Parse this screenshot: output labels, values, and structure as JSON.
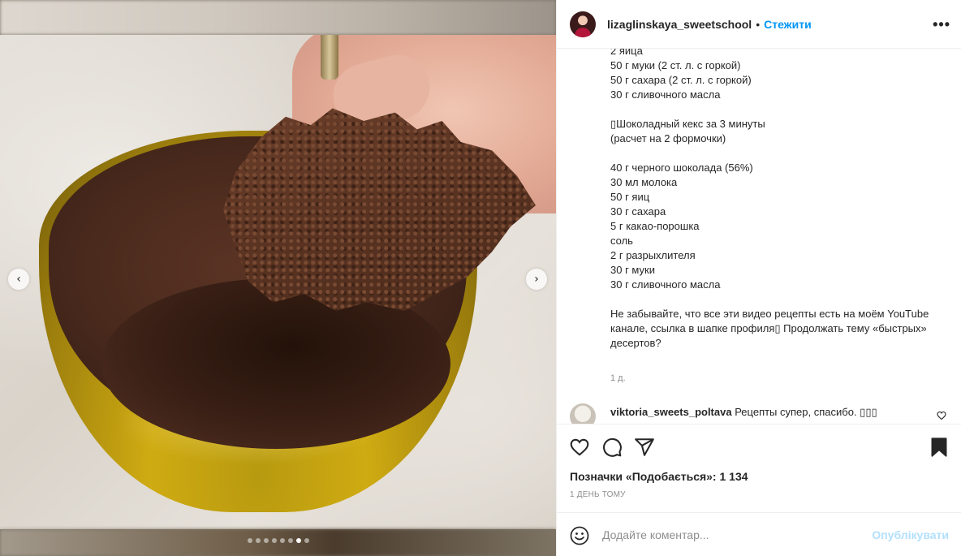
{
  "post": {
    "media": {
      "slide_count": 8,
      "active_slide": 7,
      "prev_glyph": "‹",
      "next_glyph": "›"
    },
    "header": {
      "username": "lizaglinskaya_sweetschool",
      "separator": "•",
      "follow_label": "Стежити",
      "more_glyph": "•••"
    },
    "caption": {
      "text": "2 яйца\n50 г муки (2 ст. л. с горкой)\n50 г сахара (2 ст. л. с горкой)\n30 г сливочного масла\n\n▯Шоколадный кекс за 3 минуты\n(расчет на 2 формочки)\n\n40 г черного шоколада (56%)\n30 мл молока\n50 г яиц\n30 г сахара\n5 г какао-порошка\nсоль\n2 г разрыхлителя\n30 г муки\n30 г сливочного масла\n\nНе забывайте, что все эти видео рецепты есть на моём YouTube канале, ссылка в шапке профиля▯ Продолжать тему «быстрых» десертов?",
      "age": "1 д."
    },
    "comment": {
      "username": "viktoria_sweets_poltava",
      "text": "Рецепты супер, спасибо. ▯▯▯"
    },
    "likes_label": "Позначки «Подобається»: 1 134",
    "date_label": "1 ДЕНЬ ТОМУ",
    "add_comment": {
      "placeholder": "Додайте коментар...",
      "publish_label": "Опублікувати"
    }
  },
  "colors": {
    "accent": "#0095f6",
    "publish_disabled": "#b2dffc",
    "text": "#262626",
    "muted": "#8e8e8e"
  },
  "icons": [
    "chevron-left-icon",
    "chevron-right-icon",
    "more-icon",
    "heart-icon",
    "comment-icon",
    "share-icon",
    "bookmark-icon",
    "emoji-icon",
    "small-heart-icon"
  ]
}
